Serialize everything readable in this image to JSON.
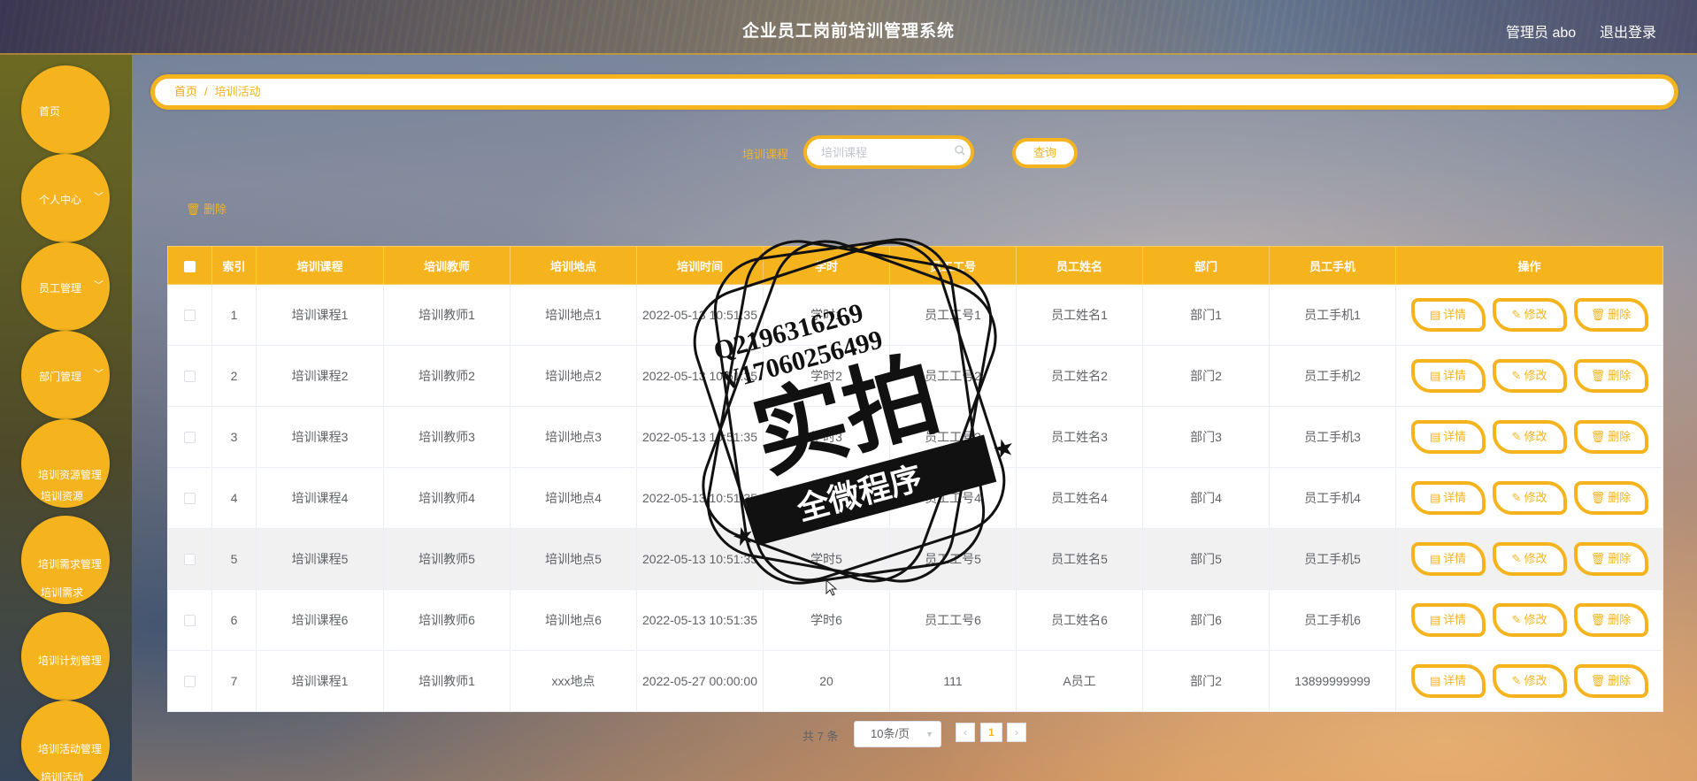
{
  "header": {
    "title": "企业员工岗前培训管理系统",
    "user": "管理员 abo",
    "logout": "退出登录"
  },
  "sidebar": {
    "items": [
      {
        "label": "首页"
      },
      {
        "label": "个人中心",
        "chevron": "﹀"
      },
      {
        "label": "员工管理",
        "chevron": "﹀"
      },
      {
        "label": "部门管理",
        "chevron": "﹀"
      },
      {
        "label": "培训资源管理",
        "sub": "培训资源"
      },
      {
        "label": "培训需求管理",
        "sub": "培训需求"
      },
      {
        "label": "培训计划管理"
      },
      {
        "label": "培训活动管理",
        "sub": "培训活动"
      }
    ]
  },
  "breadcrumb": {
    "home": "首页",
    "sep": "/",
    "current": "培训活动"
  },
  "search": {
    "label": "培训课程",
    "placeholder": "培训课程",
    "icon": "search-icon",
    "button": "查询"
  },
  "toolbar": {
    "delete": "删除",
    "delete_icon": "trash-icon"
  },
  "table": {
    "columns": [
      "",
      "索引",
      "培训课程",
      "培训教师",
      "培训地点",
      "培训时间",
      "学时",
      "员工工号",
      "员工姓名",
      "部门",
      "员工手机",
      "操作"
    ],
    "rows": [
      {
        "index": "1",
        "course": "培训课程1",
        "teacher": "培训教师1",
        "place": "培训地点1",
        "time": "2022-05-13 10:51:35",
        "hours": "学时1",
        "emp_no": "员工工号1",
        "emp_name": "员工姓名1",
        "dept": "部门1",
        "phone": "员工手机1"
      },
      {
        "index": "2",
        "course": "培训课程2",
        "teacher": "培训教师2",
        "place": "培训地点2",
        "time": "2022-05-13 10:51:35",
        "hours": "学时2",
        "emp_no": "员工工号2",
        "emp_name": "员工姓名2",
        "dept": "部门2",
        "phone": "员工手机2"
      },
      {
        "index": "3",
        "course": "培训课程3",
        "teacher": "培训教师3",
        "place": "培训地点3",
        "time": "2022-05-13 10:51:35",
        "hours": "学时3",
        "emp_no": "员工工号3",
        "emp_name": "员工姓名3",
        "dept": "部门3",
        "phone": "员工手机3"
      },
      {
        "index": "4",
        "course": "培训课程4",
        "teacher": "培训教师4",
        "place": "培训地点4",
        "time": "2022-05-13 10:51:35",
        "hours": "学时4",
        "emp_no": "员工工号4",
        "emp_name": "员工姓名4",
        "dept": "部门4",
        "phone": "员工手机4"
      },
      {
        "index": "5",
        "course": "培训课程5",
        "teacher": "培训教师5",
        "place": "培训地点5",
        "time": "2022-05-13 10:51:35",
        "hours": "学时5",
        "emp_no": "员工工号5",
        "emp_name": "员工姓名5",
        "dept": "部门5",
        "phone": "员工手机5"
      },
      {
        "index": "6",
        "course": "培训课程6",
        "teacher": "培训教师6",
        "place": "培训地点6",
        "time": "2022-05-13 10:51:35",
        "hours": "学时6",
        "emp_no": "员工工号6",
        "emp_name": "员工姓名6",
        "dept": "部门6",
        "phone": "员工手机6"
      },
      {
        "index": "7",
        "course": "培训课程1",
        "teacher": "培训教师1",
        "place": "xxx地点",
        "time": "2022-05-27 00:00:00",
        "hours": "20",
        "emp_no": "111",
        "emp_name": "A员工",
        "dept": "部门2",
        "phone": "13899999999"
      }
    ],
    "actions": [
      {
        "label": "详情",
        "icon": "document-icon",
        "glyph": "▤"
      },
      {
        "label": "修改",
        "icon": "edit-icon",
        "glyph": "✎"
      },
      {
        "label": "删除",
        "icon": "trash-icon",
        "glyph": "🗑"
      }
    ]
  },
  "pagination": {
    "total": "共 7 条",
    "page_size": "10条/页",
    "page": "1",
    "prev": "‹",
    "next": "›"
  },
  "watermark": {
    "line1": "Q2196316269",
    "line2": "V17060256499",
    "main": "实拍",
    "banner": "全微程序"
  },
  "colors": {
    "accent": "#f5b41e",
    "header_text": "#ffffff",
    "sidebar_bg": "#6c6a22"
  }
}
